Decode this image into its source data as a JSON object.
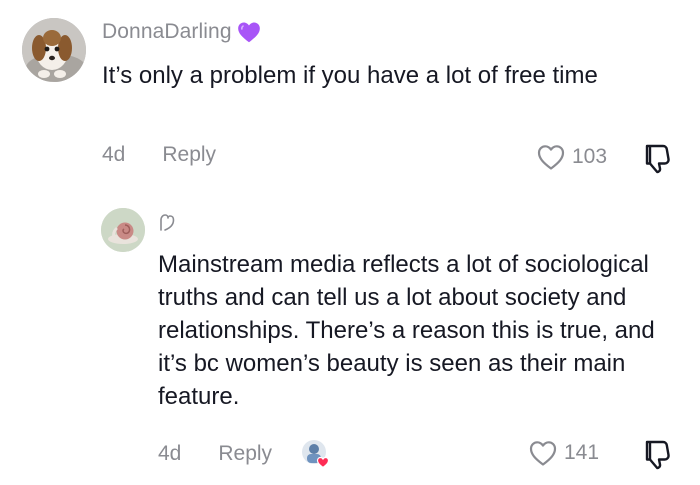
{
  "comment": {
    "username": "DonnaDarling",
    "badge_icon": "purple-heart-icon",
    "text": "It’s only a problem if you have a lot of free time",
    "time": "4d",
    "reply_label": "Reply",
    "likes": "103"
  },
  "reply": {
    "marker_icon": "creator-reply-icon",
    "text": "Mainstream media reflects a lot of sociological truths and can tell us a lot about society and relationships. There’s a reason this is true, and it’s bc women’s beauty is seen as their main feature.",
    "time": "4d",
    "reply_label": "Reply",
    "liked_by_creator_icon": "creator-liked-avatar",
    "likes": "141"
  },
  "colors": {
    "text": "#161823",
    "muted": "#8a8b91",
    "badge": "#a855f7",
    "heart": "#fe2c55"
  }
}
